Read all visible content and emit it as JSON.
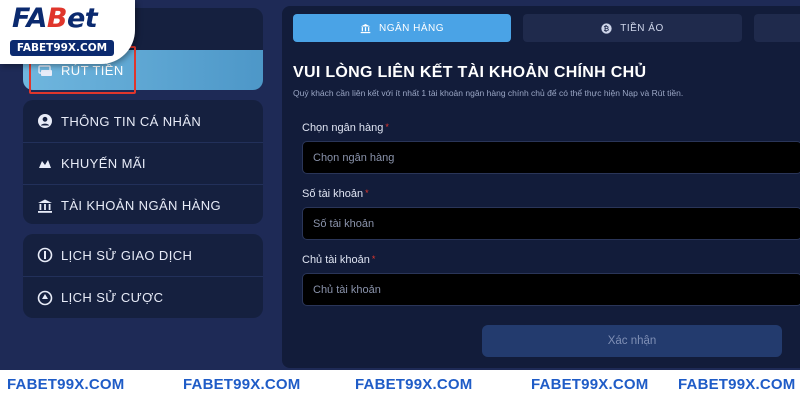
{
  "logo": {
    "text_main_a": "FA",
    "text_main_b": "B",
    "text_main_c": "et",
    "subtitle": "FABET99X.COM"
  },
  "sidebar": {
    "active_item": {
      "label": "RÚT TIỀN",
      "icon": "withdraw-icon"
    },
    "group2": [
      {
        "label": "THÔNG TIN CÁ NHÂN",
        "icon": "user-icon"
      },
      {
        "label": "KHUYẾN MÃI",
        "icon": "gift-icon"
      },
      {
        "label": "TÀI KHOẢN NGÂN HÀNG",
        "icon": "bank-icon"
      }
    ],
    "group3": [
      {
        "label": "LỊCH SỬ GIAO DỊCH",
        "icon": "coin-history-icon"
      },
      {
        "label": "LỊCH SỬ CƯỢC",
        "icon": "bet-history-icon"
      }
    ]
  },
  "tabs": [
    {
      "label": "NGÂN HÀNG",
      "icon": "bank-icon",
      "active": true
    },
    {
      "label": "TIỀN ẢO",
      "icon": "bitcoin-icon",
      "active": false
    },
    {
      "label": "",
      "icon": "",
      "active": false
    }
  ],
  "form": {
    "title": "VUI LÒNG LIÊN KẾT TÀI KHOẢN CHÍNH CHỦ",
    "subtitle": "Quý khách cần liên kết với ít nhất 1 tài khoản ngân hàng chính chủ để có thể thực hiện Nạp và Rút tiền.",
    "required_mark": "*",
    "fields": [
      {
        "label": "Chọn ngân hàng",
        "placeholder": "Chọn ngân hàng"
      },
      {
        "label": "Số tài khoản",
        "placeholder": "Số tài khoản"
      },
      {
        "label": "Chủ tài khoản",
        "placeholder": "Chủ tài khoản"
      }
    ],
    "submit_label": "Xác nhận"
  },
  "watermark": {
    "items": [
      "FABET99X.COM",
      "FABET99X.COM",
      "FABET99X.COM",
      "FABET99X.COM",
      "FABET99X.COM"
    ]
  },
  "colors": {
    "accent": "#4aa3e6",
    "active_sidebar": "#6fb6de",
    "highlight": "#e0362c",
    "background": "#1e2a56"
  }
}
